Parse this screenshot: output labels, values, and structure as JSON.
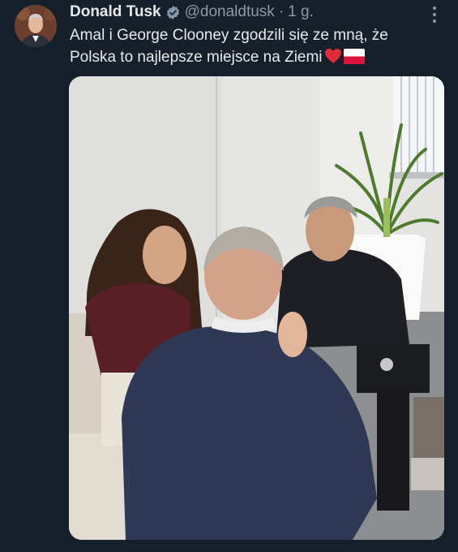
{
  "tweet": {
    "author_name": "Donald Tusk",
    "author_handle": "@donaldtusk",
    "separator": "·",
    "time": "1 g.",
    "text_line1": "Amal i George Clooney zgodzili się ze mną, że",
    "text_line2": "Polska to najlepsze miejsce na Ziemi",
    "emojis": [
      "red-heart",
      "flag-poland"
    ]
  },
  "colors": {
    "background": "#15202b",
    "text": "#e7e9ea",
    "secondary_text": "#8b98a5",
    "verified_badge": "#829aab"
  },
  "icons": [
    "verified-badge-icon",
    "more-options-icon",
    "red-heart-emoji",
    "poland-flag-emoji"
  ]
}
